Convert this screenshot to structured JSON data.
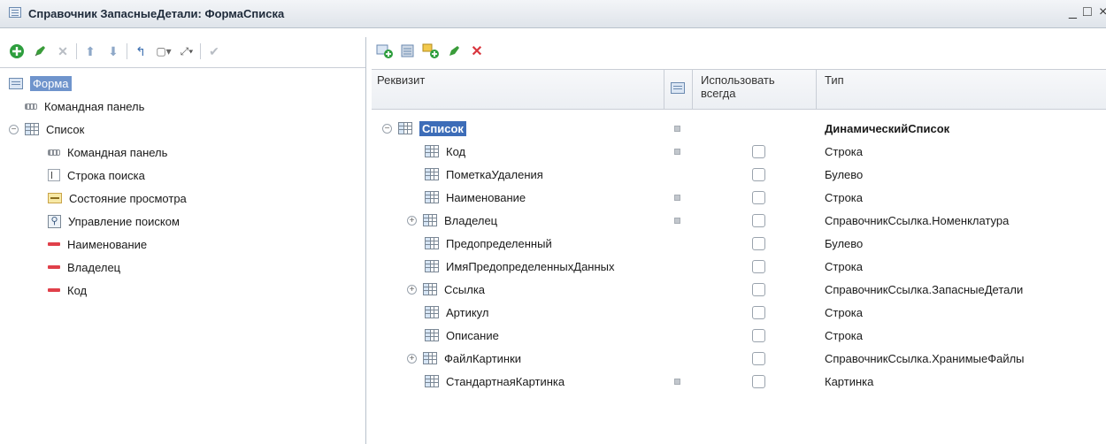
{
  "window": {
    "title": "Справочник ЗапасныеДетали: ФормаСписка",
    "controls": [
      "_",
      "□",
      "×"
    ]
  },
  "left_toolbar": {
    "icons": [
      "add-icon",
      "edit-icon",
      "delete-icon",
      "move-up-icon",
      "move-down-icon",
      "return-icon",
      "group-icon",
      "expand-icon",
      "check-icon"
    ]
  },
  "elements_tree": [
    {
      "label": "Форма",
      "icon": "form-icon",
      "level": 0,
      "selected": true
    },
    {
      "label": "Командная панель",
      "icon": "command-panel-icon",
      "level": 1
    },
    {
      "label": "Список",
      "icon": "table-icon",
      "level": 0,
      "collapsible": true
    },
    {
      "label": "Командная панель",
      "icon": "command-panel-icon",
      "level": 2
    },
    {
      "label": "Строка поиска",
      "icon": "input-field-icon",
      "level": 2
    },
    {
      "label": "Состояние просмотра",
      "icon": "view-state-icon",
      "level": 2
    },
    {
      "label": "Управление поиском",
      "icon": "search-icon",
      "level": 2
    },
    {
      "label": "Наименование",
      "icon": "field-icon",
      "level": 2
    },
    {
      "label": "Владелец",
      "icon": "field-icon",
      "level": 2
    },
    {
      "label": "Код",
      "icon": "field-icon",
      "level": 2
    }
  ],
  "right_toolbar": {
    "icons": [
      "add-attribute-icon",
      "attribute-list-icon",
      "add-nested-icon",
      "edit-icon",
      "delete-icon"
    ]
  },
  "attributes_grid": {
    "headers": {
      "attribute": "Реквизит",
      "use_always": "Использовать всегда",
      "type": "Тип"
    },
    "rows": [
      {
        "name": "Список",
        "type": "ДинамическийСписок",
        "level": 0,
        "marker": true,
        "checkbox": false,
        "expander": "collapse",
        "selected": true,
        "bold_type": true
      },
      {
        "name": "Код",
        "type": "Строка",
        "level": 1,
        "marker": true,
        "checkbox": true,
        "expander": ""
      },
      {
        "name": "ПометкаУдаления",
        "type": "Булево",
        "level": 1,
        "marker": false,
        "checkbox": true,
        "expander": ""
      },
      {
        "name": "Наименование",
        "type": "Строка",
        "level": 1,
        "marker": true,
        "checkbox": true,
        "expander": ""
      },
      {
        "name": "Владелец",
        "type": "СправочникСсылка.Номенклатура",
        "level": 1,
        "marker": true,
        "checkbox": true,
        "expander": "expand"
      },
      {
        "name": "Предопределенный",
        "type": "Булево",
        "level": 1,
        "marker": false,
        "checkbox": true,
        "expander": ""
      },
      {
        "name": "ИмяПредопределенныхДанных",
        "type": "Строка",
        "level": 1,
        "marker": false,
        "checkbox": true,
        "expander": ""
      },
      {
        "name": "Ссылка",
        "type": "СправочникСсылка.ЗапасныеДетали",
        "level": 1,
        "marker": false,
        "checkbox": true,
        "expander": "expand"
      },
      {
        "name": "Артикул",
        "type": "Строка",
        "level": 1,
        "marker": false,
        "checkbox": true,
        "expander": ""
      },
      {
        "name": "Описание",
        "type": "Строка",
        "level": 1,
        "marker": false,
        "checkbox": true,
        "expander": ""
      },
      {
        "name": "ФайлКартинки",
        "type": "СправочникСсылка.ХранимыеФайлы",
        "level": 1,
        "marker": false,
        "checkbox": true,
        "expander": "expand"
      },
      {
        "name": "СтандартнаяКартинка",
        "type": "Картинка",
        "level": 1,
        "marker": true,
        "checkbox": true,
        "expander": ""
      }
    ]
  },
  "colors": {
    "selection": "#3d6db8",
    "toolbar_green": "#2e9e3e",
    "toolbar_red": "#d9363e"
  }
}
